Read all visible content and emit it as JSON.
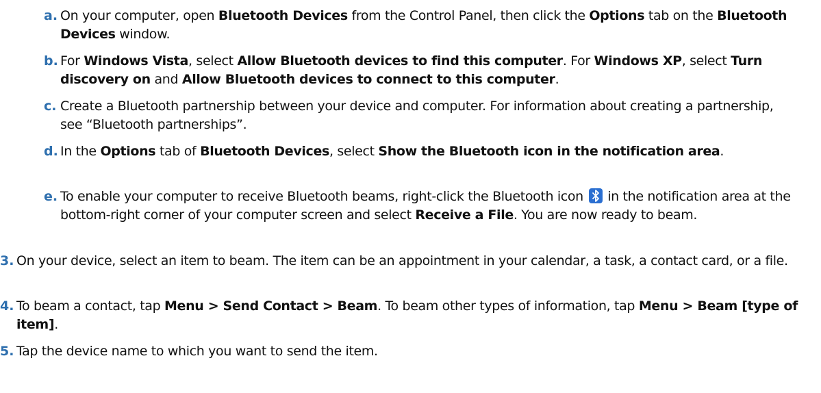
{
  "steps": {
    "a": {
      "marker": "a.",
      "t1": "On your computer, open ",
      "b1": "Bluetooth Devices",
      "t2": " from the Control Panel, then click the ",
      "b2": "Options",
      "t3": " tab on the ",
      "b3": "Bluetooth Devices",
      "t4": " window."
    },
    "b": {
      "marker": "b.",
      "t1": "For ",
      "b1": "Windows Vista",
      "t2": ", select ",
      "b2": "Allow Bluetooth devices to find this computer",
      "t3": ". For ",
      "b3": "Windows XP",
      "t4": ", select ",
      "b4": "Turn discovery on",
      "t5": " and ",
      "b5": "Allow Bluetooth devices to connect to this computer",
      "t6": "."
    },
    "c": {
      "marker": "c.",
      "t1": "Create a Bluetooth partnership between your device and computer. For information about creating a partnership, see “Bluetooth partnerships”."
    },
    "d": {
      "marker": "d.",
      "t1": "In the ",
      "b1": "Options",
      "t2": " tab of ",
      "b2": "Bluetooth Devices",
      "t3": ", select ",
      "b3": "Show the Bluetooth icon in the notification area",
      "t4": "."
    },
    "e": {
      "marker": "e.",
      "t1": "To enable your computer to receive Bluetooth beams, right-click the Bluetooth icon ",
      "icon": "bluetooth-icon",
      "t2": " in the notification area at the bottom-right corner of your computer screen and select ",
      "b1": "Receive a File",
      "t3": ". You are now ready to beam."
    },
    "s3": {
      "marker": "3.",
      "t1": "On your device, select an item to beam. The item can be an appointment in your calendar, a task, a contact card, or a file."
    },
    "s4": {
      "marker": "4.",
      "t1": "To beam a contact, tap ",
      "b1": "Menu > Send Contact > Beam",
      "t2": ". To beam other types of information, tap ",
      "b2": "Menu > Beam [type of item]",
      "t3": "."
    },
    "s5": {
      "marker": "5.",
      "t1": "Tap the device name to which you want to send the item."
    }
  },
  "colors": {
    "marker": "#2e6fae",
    "icon_bg": "#2b6fd1"
  }
}
